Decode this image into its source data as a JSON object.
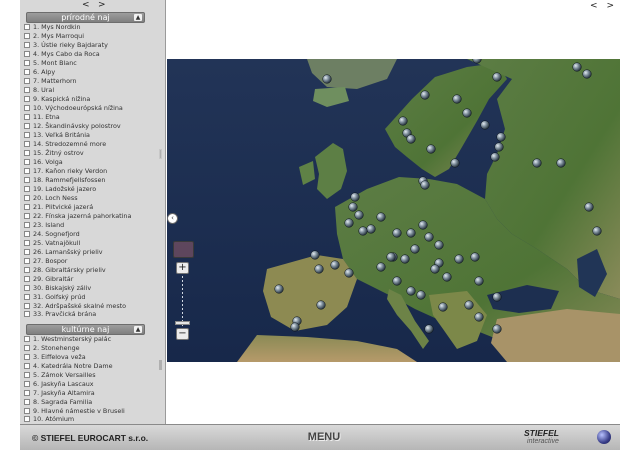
{
  "sidebar": {
    "nav_prev": "<",
    "nav_next": ">",
    "section1": {
      "title": "prírodné naj",
      "toggle": "▲",
      "items": [
        "1. Mys Nordkin",
        "2. Mys Marroqui",
        "3. Ústie rieky Bajdaraty",
        "4. Mys Cabo da Roca",
        "5. Mont Blanc",
        "6. Alpy",
        "7. Matterhorn",
        "8. Ural",
        "9. Kaspická nížina",
        "10. Východoeurópská nížina",
        "11. Etna",
        "12. Škandinávsky polostrov",
        "13. Veľká Británia",
        "14. Stredozemné more",
        "15. Žitný ostrov",
        "16. Volga",
        "17. Kaňon rieky Verdon",
        "18. Rammefjellsfossen",
        "19. Ladožské jazero",
        "20. Loch Ness",
        "21. Plitvické jazerá",
        "22. Fínska jazerná pahorkatina",
        "23. Island",
        "24. Sognefjord",
        "25. Vatnajökull",
        "26. Lamanšský prieliv",
        "27. Bospor",
        "28. Gibraltársky prieliv",
        "29. Gibraltár",
        "30. Biskajský záliv",
        "31. Golfský prúd",
        "32. Adršpašské skalné mesto",
        "33. Pravčická brána"
      ]
    },
    "section2": {
      "title": "kultúrne naj",
      "toggle": "▲",
      "items": [
        "1. Westminsterský palác",
        "2. Stonehenge",
        "3. Eiffelova veža",
        "4. Katedrála Notre Dame",
        "5. Zámok Versailles",
        "6. Jaskyňa Lascaux",
        "7. Jaskyňa Altamira",
        "8. Sagrada Familia",
        "9. Hlavné námestie v Bruseli",
        "10. Atómium"
      ]
    }
  },
  "map": {
    "nav_prev": "<",
    "nav_next": ">",
    "collapse_symbol": "‹",
    "zoom_in": "+",
    "zoom_out": "−"
  },
  "footer": {
    "copyright": "© STIEFEL EUROCART s.r.o.",
    "menu": "MENU",
    "brand_main": "STIEFEL",
    "brand_sub": "interactive"
  },
  "colors": {
    "sea": "#1b2a4a",
    "land": "#4f7a3a",
    "marker": "#8a9aa8"
  }
}
